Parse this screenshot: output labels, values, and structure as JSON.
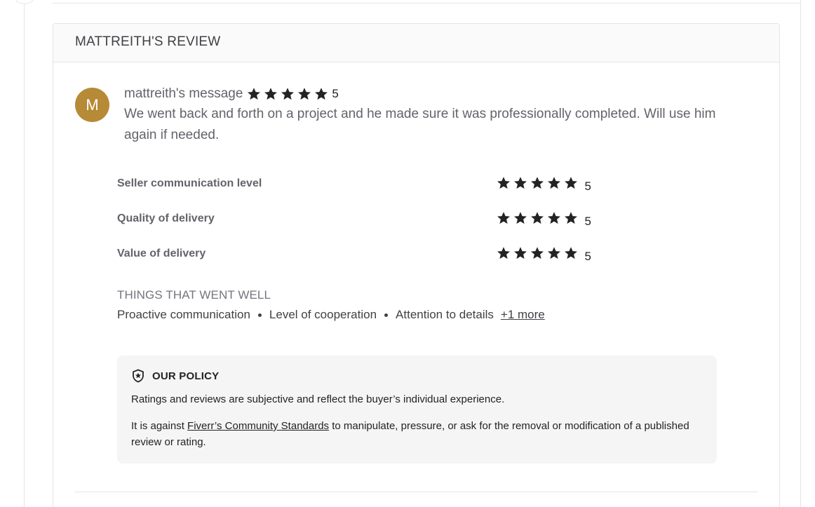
{
  "review": {
    "title": "MATTREITH'S REVIEW",
    "avatar_initial": "M",
    "avatar_color": "#b68a36",
    "message_title": "mattreith's message",
    "overall_rating": 5,
    "overall_score": "5",
    "message_body": "We went back and forth on a project and he made sure it was professionally completed. Will use him again if needed."
  },
  "ratings": [
    {
      "label": "Seller communication level",
      "rating": 5,
      "score": "5"
    },
    {
      "label": "Quality of delivery",
      "rating": 5,
      "score": "5"
    },
    {
      "label": "Value of delivery",
      "rating": 5,
      "score": "5"
    }
  ],
  "things_went_well": {
    "title": "THINGS THAT WENT WELL",
    "tags": [
      "Proactive communication",
      "Level of cooperation",
      "Attention to details"
    ],
    "more_label": "+1 more"
  },
  "policy": {
    "title": "OUR POLICY",
    "icon": "shield-star-icon",
    "text1": "Ratings and reviews are subjective and reflect the buyer’s individual experience.",
    "text2_prefix": "It is against ",
    "text2_link": "Fiverr’s Community Standards",
    "text2_suffix": " to manipulate, pressure, or ask for the removal or modification of a published review or rating."
  },
  "colors": {
    "star": "#222325",
    "text_primary": "#404145",
    "text_secondary": "#62646a"
  }
}
